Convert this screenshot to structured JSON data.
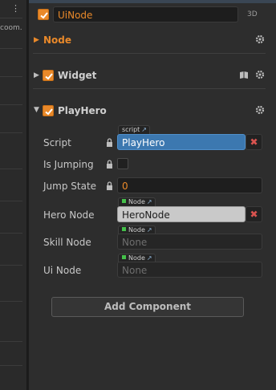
{
  "left_panel": {
    "edge_text": "coom.",
    "dots": "⋮"
  },
  "node": {
    "name": "UiNode",
    "mode_label": "3D"
  },
  "sections": {
    "node": {
      "title": "Node"
    },
    "widget": {
      "title": "Widget"
    },
    "playhero": {
      "title": "PlayHero",
      "props": {
        "script": {
          "label": "Script",
          "tag": "script",
          "value": "PlayHero"
        },
        "is_jumping": {
          "label": "Is Jumping"
        },
        "jump_state": {
          "label": "Jump State",
          "value": "0"
        },
        "hero_node": {
          "label": "Hero Node",
          "tag": "Node",
          "value": "HeroNode"
        },
        "skill_node": {
          "label": "Skill Node",
          "tag": "Node",
          "value": "None"
        },
        "ui_node": {
          "label": "Ui Node",
          "tag": "Node",
          "value": "None"
        }
      }
    }
  },
  "clear_glyph": "✖",
  "add_component_label": "Add Component",
  "colors": {
    "accent": "#e9892a",
    "script_field": "#3c78b0",
    "remove": "#d9534f",
    "node_tag": "#44c04a"
  }
}
